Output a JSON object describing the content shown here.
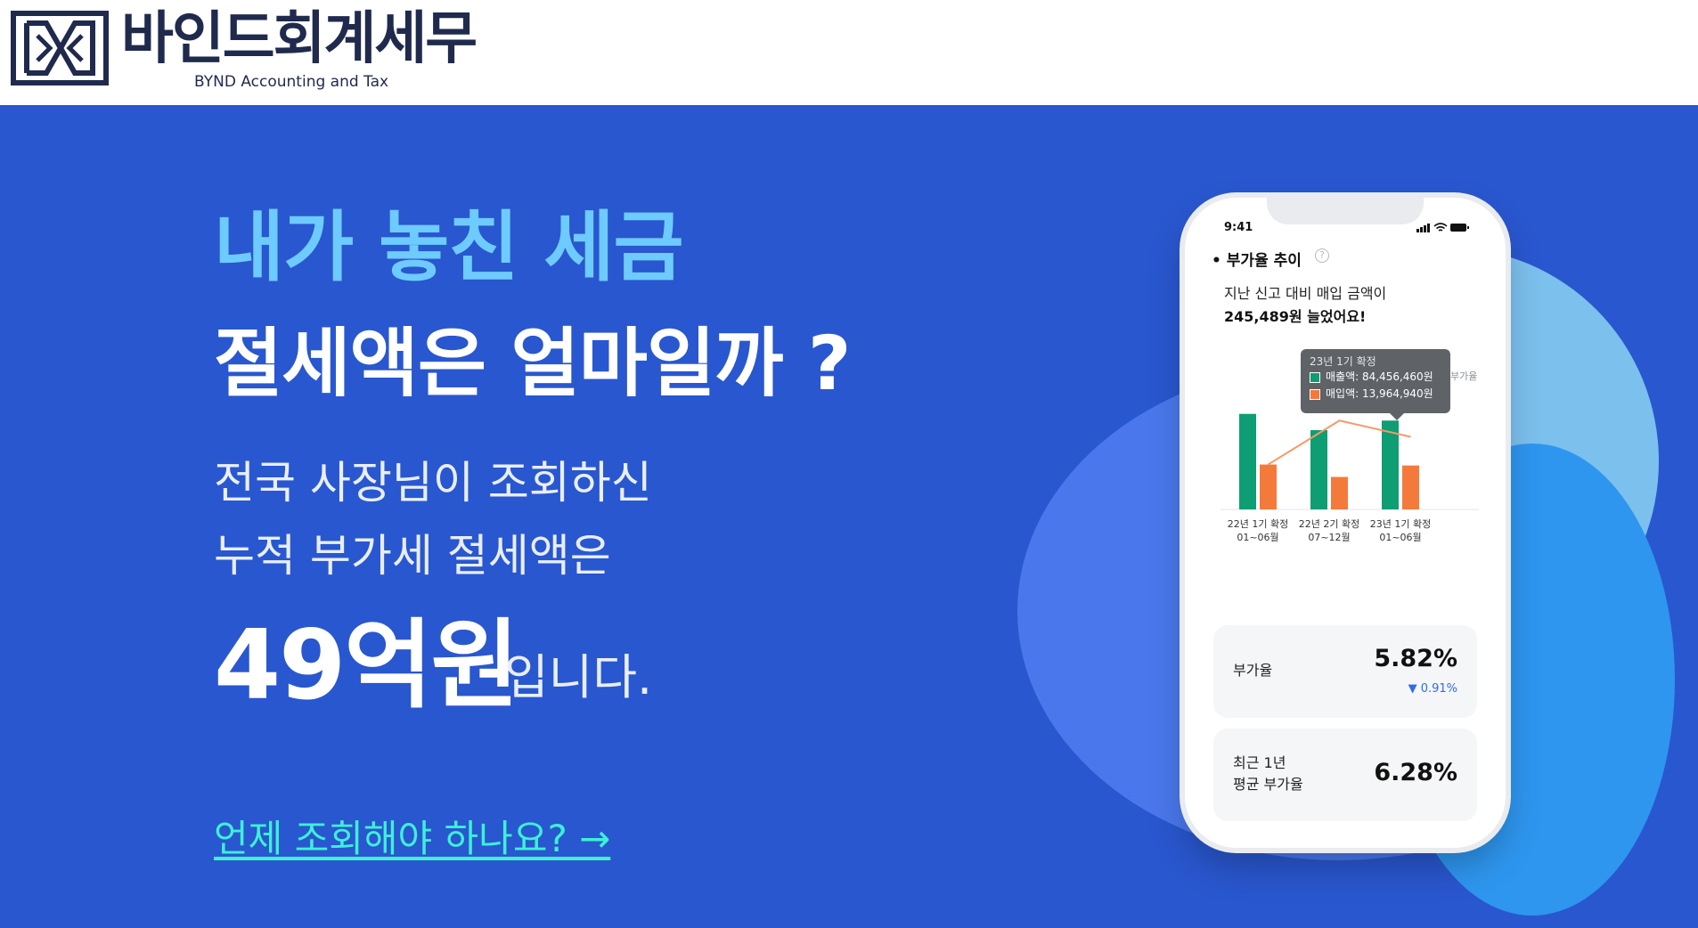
{
  "header": {
    "logo_title": "바인드회계세무",
    "logo_subtitle": "BYND Accounting and Tax"
  },
  "hero": {
    "headline_accent": "내가 놓친 세금",
    "headline_main": "절세액은 얼마일까 ?",
    "sub_line1": "전국 사장님이 조회하신",
    "sub_line2": "누적 부가세 절세액은",
    "amount": "49억원",
    "amount_suffix": "입니다.",
    "cta_link": "언제 조회해야 하나요? →"
  },
  "colors": {
    "brand_blue": "#2957cf",
    "accent_sky": "#6ecbff",
    "cta_mint": "#3df0d6",
    "sales_green": "#0f9d73",
    "purchase_orange": "#f47a3c"
  },
  "phone": {
    "status_time": "9:41",
    "section_title": "• 부가율 추이",
    "help_icon": "?",
    "message_line1": "지난 신고 대비 매입 금액이",
    "message_line2": "245,489원 늘었어요!",
    "tooltip": {
      "title": "23년 1기 확정",
      "sales_label": "매출액: 84,456,460원",
      "purchase_label": "매입액: 13,964,940원"
    },
    "legend_tag": "부가율",
    "card1": {
      "label": "부가율",
      "value": "5.82%",
      "delta": "▼ 0.91%"
    },
    "card2": {
      "label_line1": "최근 1년",
      "label_line2": "평균 부가율",
      "value": "6.28%"
    }
  },
  "chart_data": {
    "type": "bar",
    "categories": [
      [
        "22년 1기 확정",
        "01~06월"
      ],
      [
        "22년 2기 확정",
        "07~12월"
      ],
      [
        "23년 1기 확정",
        "01~06월"
      ]
    ],
    "series": [
      {
        "name": "매출액",
        "color": "#0f9d73",
        "values": [
          100,
          83,
          93
        ]
      },
      {
        "name": "매입액",
        "color": "#f47a3c",
        "values": [
          47,
          34,
          46
        ]
      }
    ],
    "line": {
      "name": "부가율",
      "color": "#f59a6a",
      "values": [
        47,
        93,
        76
      ]
    },
    "ylim": [
      0,
      110
    ]
  }
}
